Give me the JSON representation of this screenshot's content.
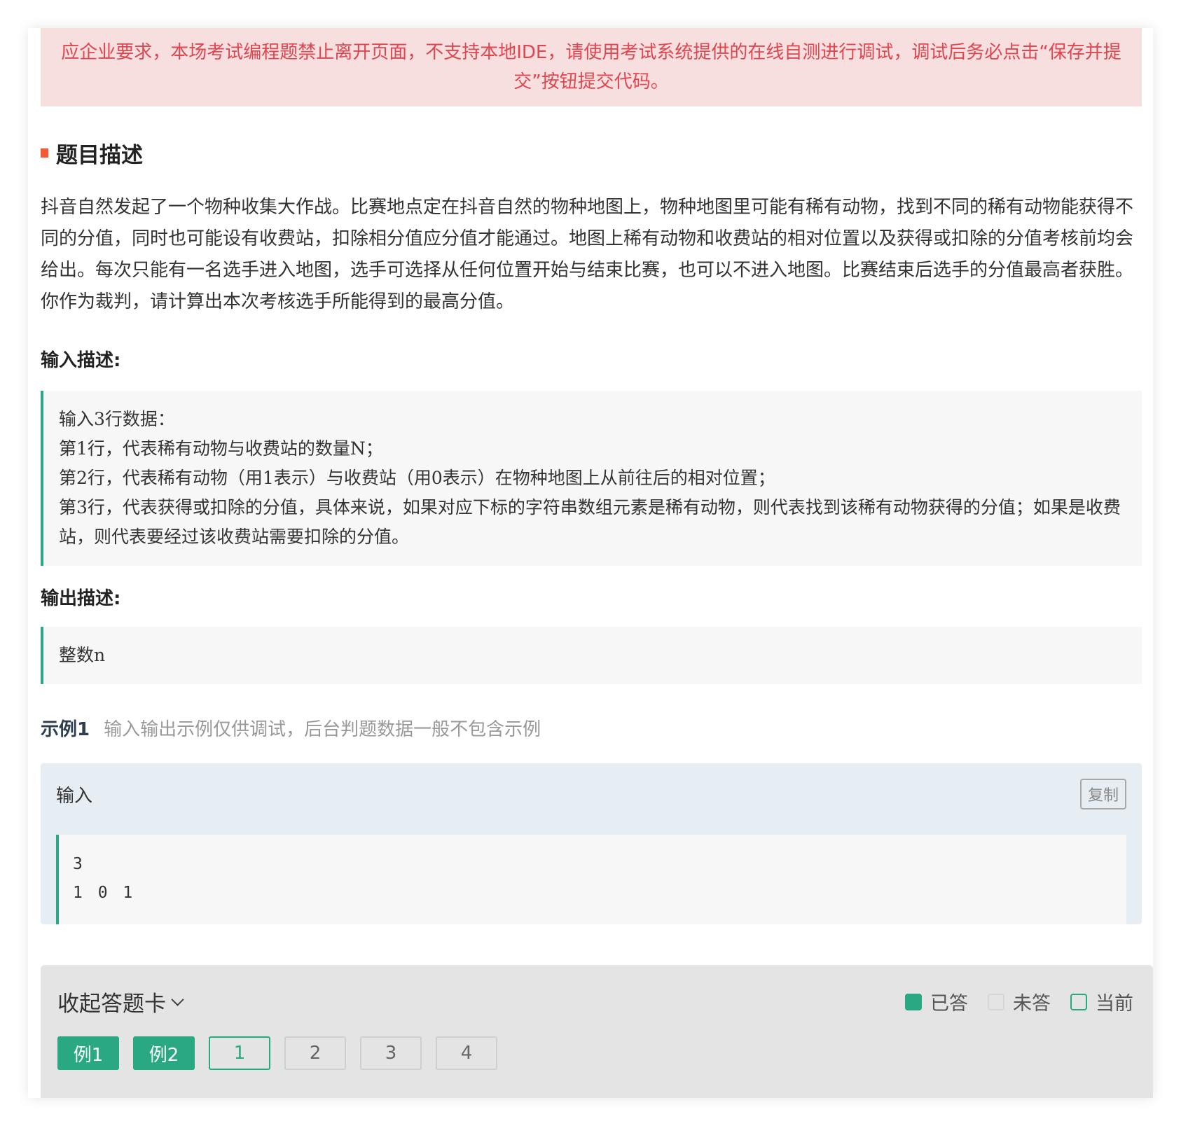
{
  "banner": {
    "text": "应企业要求，本场考试编程题禁止离开页面，不支持本地IDE，请使用考试系统提供的在线自测进行调试，调试后务必点击“保存并提交”按钮提交代码。"
  },
  "problem": {
    "section_title": "题目描述",
    "description": "抖音自然发起了一个物种收集大作战。比赛地点定在抖音自然的物种地图上，物种地图里可能有稀有动物，找到不同的稀有动物能获得不同的分值，同时也可能设有收费站，扣除相分值应分值才能通过。地图上稀有动物和收费站的相对位置以及获得或扣除的分值考核前均会给出。每次只能有一名选手进入地图，选手可选择从任何位置开始与结束比赛，也可以不进入地图。比赛结束后选手的分值最高者获胜。你作为裁判，请计算出本次考核选手所能得到的最高分值。",
    "input_heading": "输入描述:",
    "input_lines": [
      "输入3行数据：",
      "第1行，代表稀有动物与收费站的数量N；",
      "第2行，代表稀有动物（用1表示）与收费站（用0表示）在物种地图上从前往后的相对位置；",
      "第3行，代表获得或扣除的分值，具体来说，如果对应下标的字符串数组元素是稀有动物，则代表找到该稀有动物获得的分值；如果是收费站，则代表要经过该收费站需要扣除的分值。"
    ],
    "output_heading": "输出描述:",
    "output_text": "整数n"
  },
  "example": {
    "title": "示例1",
    "note": "输入输出示例仅供调试，后台判题数据一般不包含示例",
    "input_label": "输入",
    "copy_label": "复制",
    "code_lines": [
      "3",
      "1 0 1"
    ]
  },
  "answer_card": {
    "toggle_label": "收起答题卡",
    "legend": {
      "answered": "已答",
      "unanswered": "未答",
      "current": "当前"
    },
    "buttons": [
      {
        "label": "例1",
        "state": "answered"
      },
      {
        "label": "例2",
        "state": "answered"
      },
      {
        "label": "1",
        "state": "current"
      },
      {
        "label": "2",
        "state": "unanswered"
      },
      {
        "label": "3",
        "state": "unanswered"
      },
      {
        "label": "4",
        "state": "unanswered"
      }
    ]
  },
  "colors": {
    "accent": "#2aa884",
    "warning_text": "#e0464f",
    "warning_bg": "#f7dfe0",
    "title_marker": "#f05a35"
  }
}
